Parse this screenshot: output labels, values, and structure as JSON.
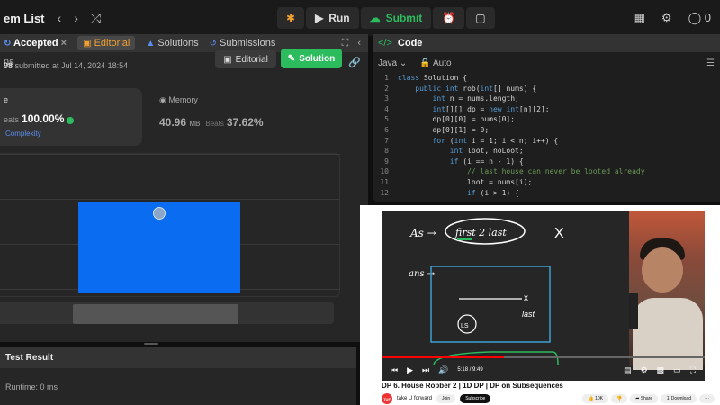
{
  "topbar": {
    "title": "em List",
    "prev_icon": "chevron-left-icon",
    "next_icon": "chevron-right-icon",
    "shuffle_icon": "shuffle-icon",
    "debug_icon": "bug-icon",
    "run_label": "Run",
    "submit_label": "Submit",
    "timer_icon": "alarm-icon",
    "note_icon": "note-icon",
    "layout_icon": "layout-grid-icon",
    "settings_icon": "gear-icon",
    "streak_count": "0"
  },
  "left_tabs": [
    {
      "label": "Accepted",
      "active": true
    },
    {
      "label": "Editorial"
    },
    {
      "label": "Solutions"
    },
    {
      "label": "Submissions"
    }
  ],
  "submission": {
    "header_fragment": "ns",
    "submitted_by": "98",
    "submitted_text": "submitted at Jul 14, 2024 18:54",
    "editorial_btn": "Editorial",
    "solution_btn": "Solution"
  },
  "runtime_card": {
    "label": "e",
    "beats_label": "eats",
    "beats_pct": "100.00%",
    "complexity_link": "Complexity"
  },
  "memory_card": {
    "label": "Memory",
    "value": "40.96",
    "unit": "MB",
    "beats_label": "Beats",
    "beats_pct": "37.62%"
  },
  "test_result": {
    "title": "Test Result",
    "runtime_text": "Runtime: 0 ms"
  },
  "code_panel": {
    "title": "Code",
    "language": "Java",
    "mode": "Auto",
    "lines": [
      {
        "n": "1",
        "text": "class Solution {"
      },
      {
        "n": "2",
        "text": "    public int rob(int[] nums) {"
      },
      {
        "n": "3",
        "text": "        int n = nums.length;"
      },
      {
        "n": "4",
        "text": "        int[][] dp = new int[n][2];"
      },
      {
        "n": "5",
        "text": "        dp[0][0] = nums[0];"
      },
      {
        "n": "6",
        "text": "        dp[0][1] = 0;"
      },
      {
        "n": "7",
        "text": "        for (int i = 1; i < n; i++) {"
      },
      {
        "n": "8",
        "text": "            int loot, noLoot;"
      },
      {
        "n": "9",
        "text": "            if (i == n - 1) {"
      },
      {
        "n": "10",
        "text": "                // last house can never be looted already"
      },
      {
        "n": "11",
        "text": "                loot = nums[i];"
      },
      {
        "n": "12",
        "text": "                if (i > 1) {"
      }
    ]
  },
  "video": {
    "time": "5:18 / 9:49",
    "title": "DP 6. House Robber 2 | 1D DP | DP on Subsequences",
    "channel": "take U forward",
    "join_label": "Join",
    "subscribe_label": "Subscribe",
    "likes": "10K",
    "share_label": "Share",
    "download_label": "Download",
    "progress": 0.38
  }
}
